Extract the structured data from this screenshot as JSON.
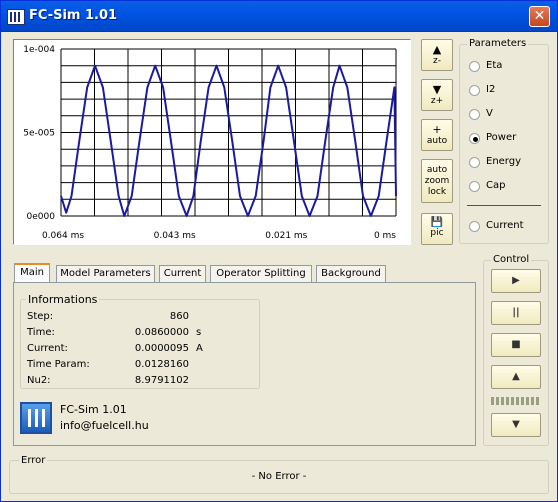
{
  "window": {
    "title": "FC-Sim 1.01",
    "close_glyph": "✕"
  },
  "chart_data": {
    "type": "line",
    "title": "",
    "xlabel": "",
    "ylabel": "",
    "x_ticks": [
      "0.064 ms",
      "0.043 ms",
      "0.021 ms",
      "0 ms"
    ],
    "y_ticks": [
      "1e-004",
      "5e-005",
      "0e000"
    ],
    "ylim": [
      0,
      0.0001
    ],
    "xlim": [
      0.064,
      0
    ],
    "grid": true,
    "line_color": "#1a1aa0",
    "series": [
      {
        "x": [
          0.064,
          0.063,
          0.062,
          0.0605,
          0.059,
          0.0575,
          0.056,
          0.0545,
          0.053,
          0.0519,
          0.0505,
          0.049,
          0.0475,
          0.046,
          0.0445,
          0.043,
          0.0415,
          0.04,
          0.0387,
          0.0373,
          0.0358,
          0.0343,
          0.0328,
          0.0313,
          0.0298,
          0.0283,
          0.0268,
          0.0253,
          0.024,
          0.0225,
          0.021,
          0.0195,
          0.018,
          0.0165,
          0.015,
          0.0135,
          0.012,
          0.0108,
          0.0093,
          0.0078,
          0.0063,
          0.0048,
          0.0033,
          0.0018,
          0.0003,
          0.0
        ],
        "y": [
          1.2e-05,
          2e-06,
          1.2e-05,
          4.5e-05,
          7.7e-05,
          9e-05,
          7.7e-05,
          4.5e-05,
          1.2e-05,
          0.0,
          1.2e-05,
          4.5e-05,
          7.7e-05,
          9e-05,
          7.7e-05,
          4.5e-05,
          1.2e-05,
          0.0,
          1.2e-05,
          4.5e-05,
          7.7e-05,
          9e-05,
          7.7e-05,
          4.5e-05,
          1.2e-05,
          0.0,
          1.2e-05,
          4.5e-05,
          7.7e-05,
          9e-05,
          7.7e-05,
          4.5e-05,
          1.2e-05,
          0.0,
          1.2e-05,
          4.5e-05,
          7.7e-05,
          9e-05,
          7.7e-05,
          4.5e-05,
          1.2e-05,
          0.0,
          1.2e-05,
          4.5e-05,
          7.7e-05,
          1.2e-05
        ]
      }
    ]
  },
  "scale_buttons": [
    {
      "icon": "▲",
      "label": "z-"
    },
    {
      "icon": "▼",
      "label": "z+"
    },
    {
      "icon": "+",
      "label": "auto"
    },
    {
      "icon": "",
      "label": "auto zoom lock"
    },
    {
      "icon": "💾",
      "label": "pic"
    }
  ],
  "parameters": {
    "legend": "Parameters",
    "options": [
      "Eta",
      "I2",
      "V",
      "Power",
      "Energy",
      "Cap"
    ],
    "selected": "Power",
    "extra_option": "Current"
  },
  "tabs": [
    "Main",
    "Model Parameters",
    "Current",
    "Operator Splitting",
    "Background"
  ],
  "active_tab": "Main",
  "informations": {
    "legend": "Informations",
    "rows": [
      {
        "label": "Step:",
        "value": "860",
        "unit": ""
      },
      {
        "label": "Time:",
        "value": "0.0860000",
        "unit": "s"
      },
      {
        "label": "Current:",
        "value": "0.0000095",
        "unit": "A"
      },
      {
        "label": "Time Param:",
        "value": "0.0128160",
        "unit": ""
      },
      {
        "label": "Nu2:",
        "value": "8.9791102",
        "unit": ""
      }
    ]
  },
  "about": {
    "name": "FC-Sim 1.01",
    "email": "info@fuelcell.hu"
  },
  "control": {
    "legend": "Control",
    "buttons": [
      "▶",
      "||",
      "■",
      "▲",
      "▼"
    ]
  },
  "error": {
    "legend": "Error",
    "text": "- No Error -"
  }
}
